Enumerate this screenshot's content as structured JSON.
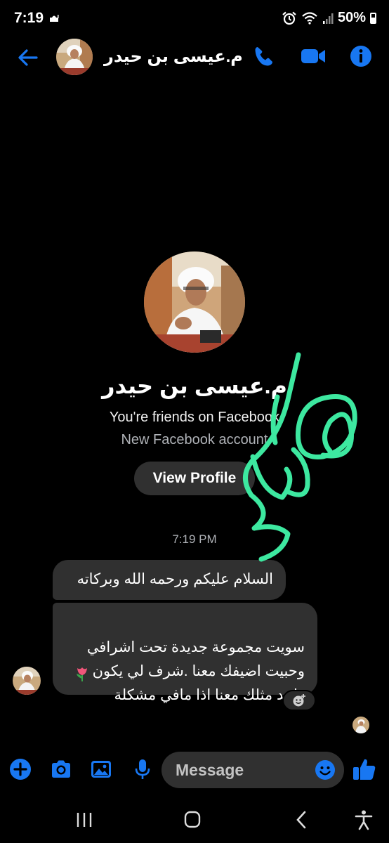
{
  "status_bar": {
    "time": "7:19",
    "battery": "50%"
  },
  "header": {
    "contact_name": "م.عيسى بن حيدر"
  },
  "intro": {
    "name": "م.عيسى بن حيدر",
    "friends_text": "You're friends on Facebook",
    "account_text": "New Facebook account",
    "view_profile_label": "View Profile"
  },
  "timestamp": "7:19 PM",
  "messages": [
    {
      "text": "السلام عليكم ورحمه الله وبركاته"
    },
    {
      "text": "سويت مجموعة جديدة تحت اشرافي\nوحبيت اضيفك معنا .شرف لي يكون\nواحد مثلك معنا اذا مافي مشكلة"
    }
  ],
  "composer": {
    "placeholder": "Message"
  },
  "colors": {
    "accent": "#1877f2",
    "bubble": "#303030",
    "scribble": "#3de8a0",
    "background": "#000000"
  }
}
